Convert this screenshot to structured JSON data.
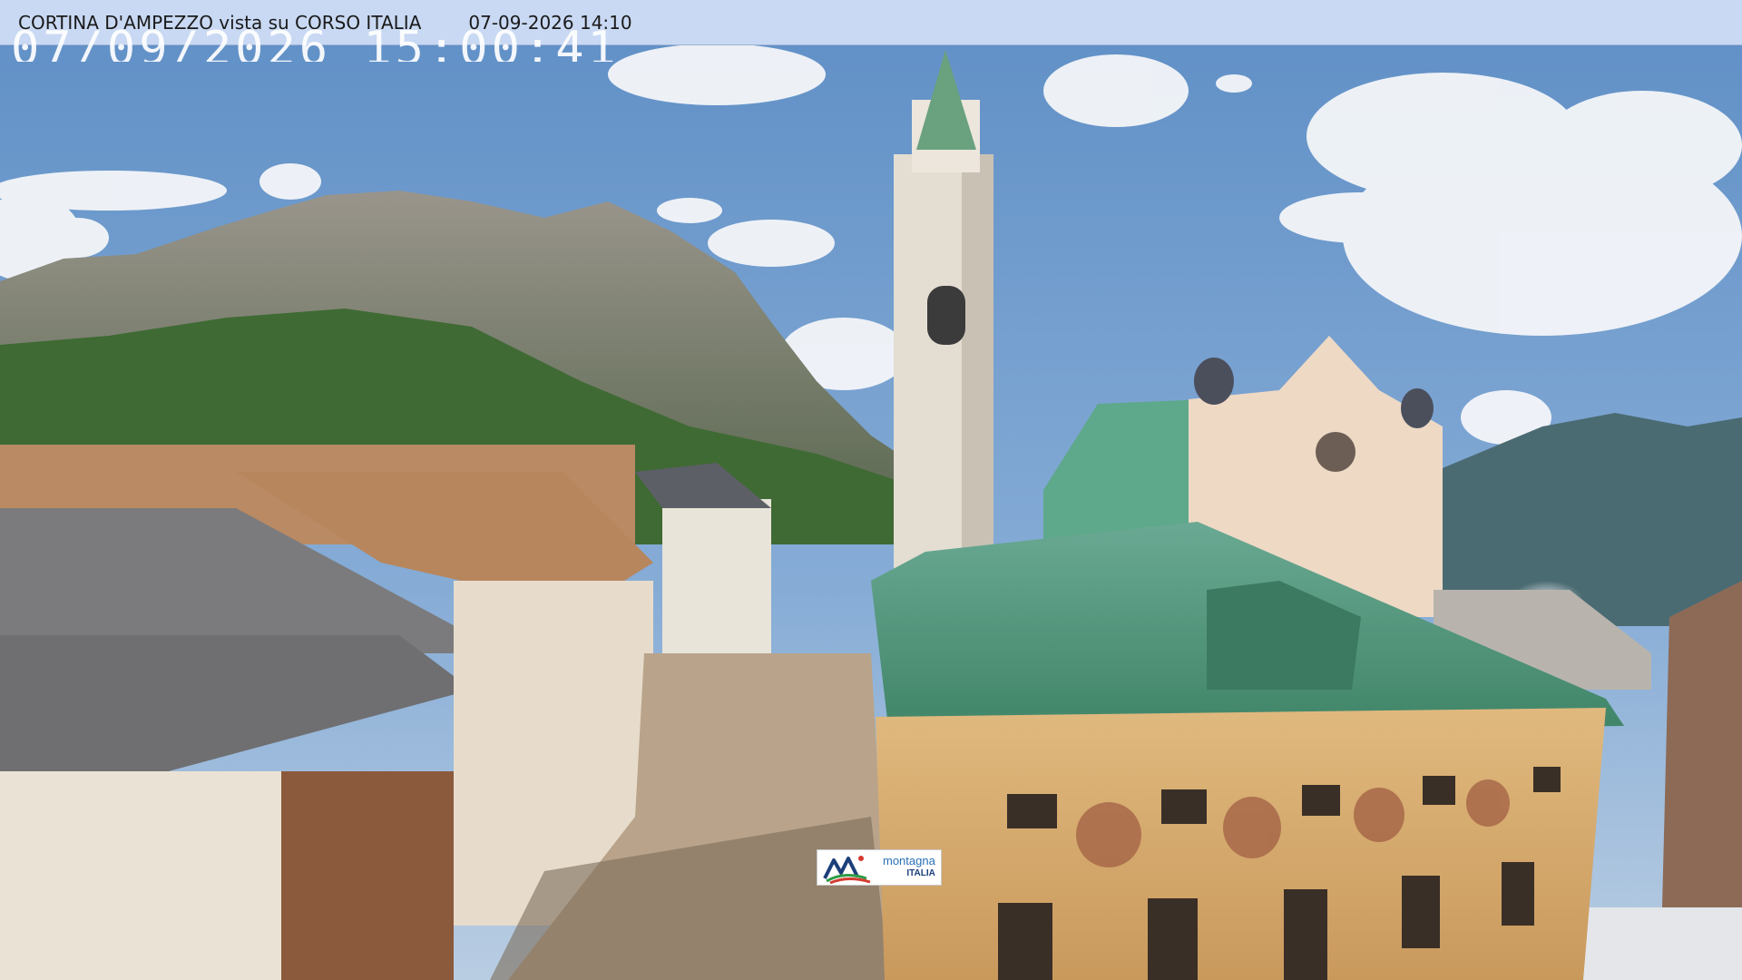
{
  "header": {
    "title": "CORTINA D'AMPEZZO vista su CORSO ITALIA",
    "datetime": "07-09-2026 14:10"
  },
  "overlay": {
    "timestamp": "07/09/2026 15:00:41"
  },
  "logo": {
    "line1": "montagna",
    "line2": "ITALIA"
  },
  "colors": {
    "sky": "#6e98c8",
    "copper_roof": "#4f9a7e",
    "facade": "#d9b27a",
    "mountain": "#8a8680",
    "forest": "#3f6a34"
  }
}
